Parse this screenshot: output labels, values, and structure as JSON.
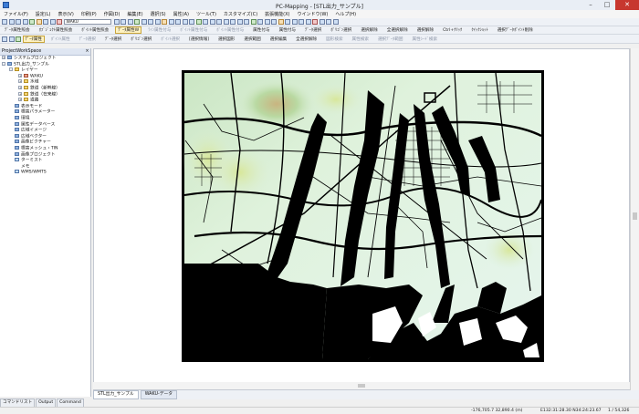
{
  "window": {
    "title": "PC-Mapping - [STL出力_サンプル]"
  },
  "menu": [
    "ファイル(F)",
    "設定(L)",
    "表示(V)",
    "印刷(P)",
    "作図(D)",
    "編集(E)",
    "選択(S)",
    "属性(A)",
    "ツール(T)",
    "カスタマイズ(C)",
    "拡張機能(X)",
    "ウインドウ(W)",
    "ヘルプ(H)"
  ],
  "toolbar1": {
    "layer_combo": "WAKU"
  },
  "toolbar2": [
    "ﾃﾞｰﾀ属性照会",
    "ｵﾌﾞｼﾞｪｸﾄ属性照会",
    "ﾎﾟｲﾝﾄ属性照会",
    "ﾃﾞｰﾀ属性W",
    "ﾗｲﾝ属性付与",
    "ﾎﾟｲﾝﾄ属性付与",
    "ﾎﾟｲﾝﾄ属性付与",
    "属性付与",
    "属性付与",
    "ﾃﾞｰﾀ選択",
    "ﾎﾟﾘｺﾞﾝ選択",
    "選択解除",
    "全選択解除",
    "選択解除",
    "Ctrl+ｸﾘｯｸ",
    "ｸｲｯｸｼｮｯﾄ",
    "選択ﾃﾞｰﾀﾎﾟｲﾝﾄ削除"
  ],
  "toolbar3": [
    "ﾃﾞｰﾀ属性",
    "ﾎﾟｲﾝﾄ属性",
    "ﾃﾞｰﾀ選択",
    "ﾃﾞｰﾀ選択",
    "ﾎﾟﾘｺﾞﾝ選択",
    "ﾎﾟｲﾝﾄ選択",
    "[選択情報]",
    "選択図形",
    "選択範囲",
    "選択編集",
    "全選択解除",
    "図形検索",
    "属性検索",
    "選択ﾃﾞｰﾀ範囲",
    "属性ｼｰﾄﾞ検索"
  ],
  "panel": {
    "header": "ProjectWorkSpace",
    "tree": [
      {
        "label": "システムプロジェクト",
        "level": 0,
        "icon": "folder"
      },
      {
        "label": "STL出力_サンプル",
        "level": 0,
        "icon": "folder"
      },
      {
        "label": "レイヤー",
        "level": 1,
        "icon": "layer-folder"
      },
      {
        "label": "WAKU",
        "level": 2,
        "icon": "layer-warn"
      },
      {
        "label": "水域",
        "level": 2,
        "icon": "layer"
      },
      {
        "label": "鉄道（新幹線）",
        "level": 2,
        "icon": "layer"
      },
      {
        "label": "鉄道（在来線）",
        "level": 2,
        "icon": "layer"
      },
      {
        "label": "道路",
        "level": 2,
        "icon": "layer"
      },
      {
        "label": "表示モード",
        "level": 1,
        "icon": "folder"
      },
      {
        "label": "標高パラメーター",
        "level": 1,
        "icon": "folder"
      },
      {
        "label": "環境",
        "level": 1,
        "icon": "folder"
      },
      {
        "label": "属性データベース",
        "level": 1,
        "icon": "folder"
      },
      {
        "label": "広域イメージ",
        "level": 1,
        "icon": "folder"
      },
      {
        "label": "広域ベクター",
        "level": 1,
        "icon": "folder"
      },
      {
        "label": "画像ビクチャー",
        "level": 1,
        "icon": "folder"
      },
      {
        "label": "標高メッシュ・TIN",
        "level": 1,
        "icon": "folder"
      },
      {
        "label": "画像プロジェクト",
        "level": 1,
        "icon": "folder"
      },
      {
        "label": "ターミスト",
        "level": 1,
        "icon": "data"
      },
      {
        "label": "メモ",
        "level": 1,
        "icon": "none"
      },
      {
        "label": "WMS/WMTS",
        "level": 1,
        "icon": "data"
      }
    ]
  },
  "bottom_panel_tabs": [
    "コマンドリスト",
    "Output",
    "Command"
  ],
  "doc_tabs": [
    "STL出力_サンプル",
    "WAKU-データ"
  ],
  "status": {
    "coords": "-176,705.7  32,890.4 (m)",
    "latlon": "E132:31:28.30  N34:24:23.67",
    "scale": "1 / 54,326"
  }
}
